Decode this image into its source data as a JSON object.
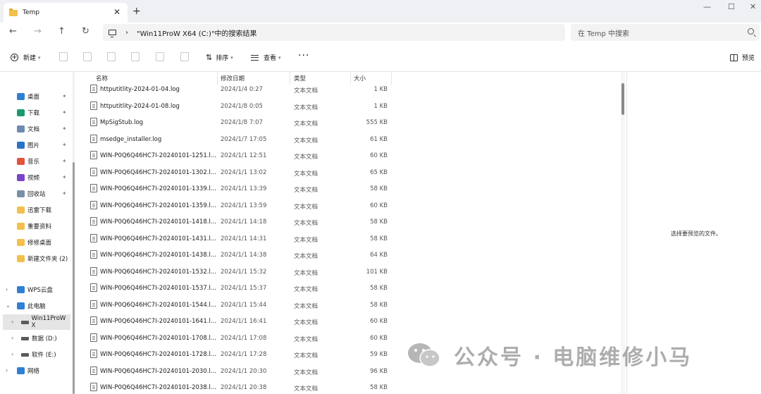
{
  "window": {
    "tab_title": "Temp",
    "tab_close": "✕",
    "new_tab": "+",
    "controls": [
      "—",
      "☐",
      "✕"
    ]
  },
  "address_bar": {
    "back": "←",
    "forward": "→",
    "up": "↑",
    "refresh": "↻",
    "path": "\"Win11ProW X64 (C:)\"中的搜索结果",
    "search_placeholder": "在 Temp 中搜索"
  },
  "toolbar": {
    "new_label": "新建",
    "sort_label": "排序",
    "view_label": "查看",
    "more_label": "···",
    "preview_label": "预览"
  },
  "sidebar": {
    "quick_access": [
      {
        "label": "桌面",
        "icon": "desktop-icon",
        "color": "#2f7fd3",
        "pinned": true
      },
      {
        "label": "下载",
        "icon": "download-icon",
        "color": "#1a9a6a",
        "pinned": true
      },
      {
        "label": "文档",
        "icon": "document-icon",
        "color": "#6d8ab0",
        "pinned": true
      },
      {
        "label": "图片",
        "icon": "pictures-icon",
        "color": "#2b73c8",
        "pinned": true
      },
      {
        "label": "音乐",
        "icon": "music-icon",
        "color": "#e2543b",
        "pinned": true
      },
      {
        "label": "视频",
        "icon": "video-icon",
        "color": "#7a45c9",
        "pinned": true
      },
      {
        "label": "回收站",
        "icon": "recycle-bin-icon",
        "color": "#7a8fa6",
        "pinned": true
      },
      {
        "label": "迅雷下载",
        "icon": "folder-icon",
        "color": "#f2c04b",
        "pinned": false
      },
      {
        "label": "重要资料",
        "icon": "folder-icon",
        "color": "#f2c04b",
        "pinned": false
      },
      {
        "label": "修修桌面",
        "icon": "folder-icon",
        "color": "#f2c04b",
        "pinned": false
      },
      {
        "label": "新建文件夹 (2)",
        "icon": "folder-icon",
        "color": "#f2c04b",
        "pinned": false
      }
    ],
    "tree": [
      {
        "label": "WPS云盘",
        "icon": "cloud-icon",
        "expanded": false
      },
      {
        "label": "此电脑",
        "icon": "pc-icon",
        "expanded": true
      },
      {
        "label": "Win11ProW X",
        "icon": "drive-icon",
        "expanded": false,
        "selected": true
      },
      {
        "label": "数据 (D:)",
        "icon": "drive-icon",
        "expanded": false
      },
      {
        "label": "软件 (E:)",
        "icon": "drive-icon",
        "expanded": false
      },
      {
        "label": "网络",
        "icon": "network-icon",
        "expanded": false
      }
    ]
  },
  "file_list": {
    "columns": {
      "name": "名称",
      "date": "修改日期",
      "type": "类型",
      "size": "大小"
    },
    "rows": [
      {
        "name": "httputitlity-2024-01-04.log",
        "date": "2024/1/4 0:27",
        "type": "文本文档",
        "size": "1 KB"
      },
      {
        "name": "httputitlity-2024-01-08.log",
        "date": "2024/1/8 0:05",
        "type": "文本文档",
        "size": "1 KB"
      },
      {
        "name": "MpSigStub.log",
        "date": "2024/1/8 7:07",
        "type": "文本文档",
        "size": "555 KB"
      },
      {
        "name": "msedge_installer.log",
        "date": "2024/1/7 17:05",
        "type": "文本文档",
        "size": "61 KB"
      },
      {
        "name": "WIN-P0Q6Q46HC7I-20240101-1251.l...",
        "date": "2024/1/1 12:51",
        "type": "文本文档",
        "size": "60 KB"
      },
      {
        "name": "WIN-P0Q6Q46HC7I-20240101-1302.l...",
        "date": "2024/1/1 13:02",
        "type": "文本文档",
        "size": "65 KB"
      },
      {
        "name": "WIN-P0Q6Q46HC7I-20240101-1339.l...",
        "date": "2024/1/1 13:39",
        "type": "文本文档",
        "size": "58 KB"
      },
      {
        "name": "WIN-P0Q6Q46HC7I-20240101-1359.l...",
        "date": "2024/1/1 13:59",
        "type": "文本文档",
        "size": "60 KB"
      },
      {
        "name": "WIN-P0Q6Q46HC7I-20240101-1418.l...",
        "date": "2024/1/1 14:18",
        "type": "文本文档",
        "size": "58 KB"
      },
      {
        "name": "WIN-P0Q6Q46HC7I-20240101-1431.l...",
        "date": "2024/1/1 14:31",
        "type": "文本文档",
        "size": "58 KB"
      },
      {
        "name": "WIN-P0Q6Q46HC7I-20240101-1438.l...",
        "date": "2024/1/1 14:38",
        "type": "文本文档",
        "size": "64 KB"
      },
      {
        "name": "WIN-P0Q6Q46HC7I-20240101-1532.l...",
        "date": "2024/1/1 15:32",
        "type": "文本文档",
        "size": "101 KB"
      },
      {
        "name": "WIN-P0Q6Q46HC7I-20240101-1537.l...",
        "date": "2024/1/1 15:37",
        "type": "文本文档",
        "size": "58 KB"
      },
      {
        "name": "WIN-P0Q6Q46HC7I-20240101-1544.l...",
        "date": "2024/1/1 15:44",
        "type": "文本文档",
        "size": "58 KB"
      },
      {
        "name": "WIN-P0Q6Q46HC7I-20240101-1641.l...",
        "date": "2024/1/1 16:41",
        "type": "文本文档",
        "size": "60 KB"
      },
      {
        "name": "WIN-P0Q6Q46HC7I-20240101-1708.l...",
        "date": "2024/1/1 17:08",
        "type": "文本文档",
        "size": "60 KB"
      },
      {
        "name": "WIN-P0Q6Q46HC7I-20240101-1728.l...",
        "date": "2024/1/1 17:28",
        "type": "文本文档",
        "size": "59 KB"
      },
      {
        "name": "WIN-P0Q6Q46HC7I-20240101-2030.l...",
        "date": "2024/1/1 20:30",
        "type": "文本文档",
        "size": "96 KB"
      },
      {
        "name": "WIN-P0Q6Q46HC7I-20240101-2038.l...",
        "date": "2024/1/1 20:38",
        "type": "文本文档",
        "size": "58 KB"
      }
    ]
  },
  "preview_pane": {
    "message": "选择要预览的文件。"
  },
  "watermark": {
    "text": "公众号 · 电脑维修小马"
  }
}
